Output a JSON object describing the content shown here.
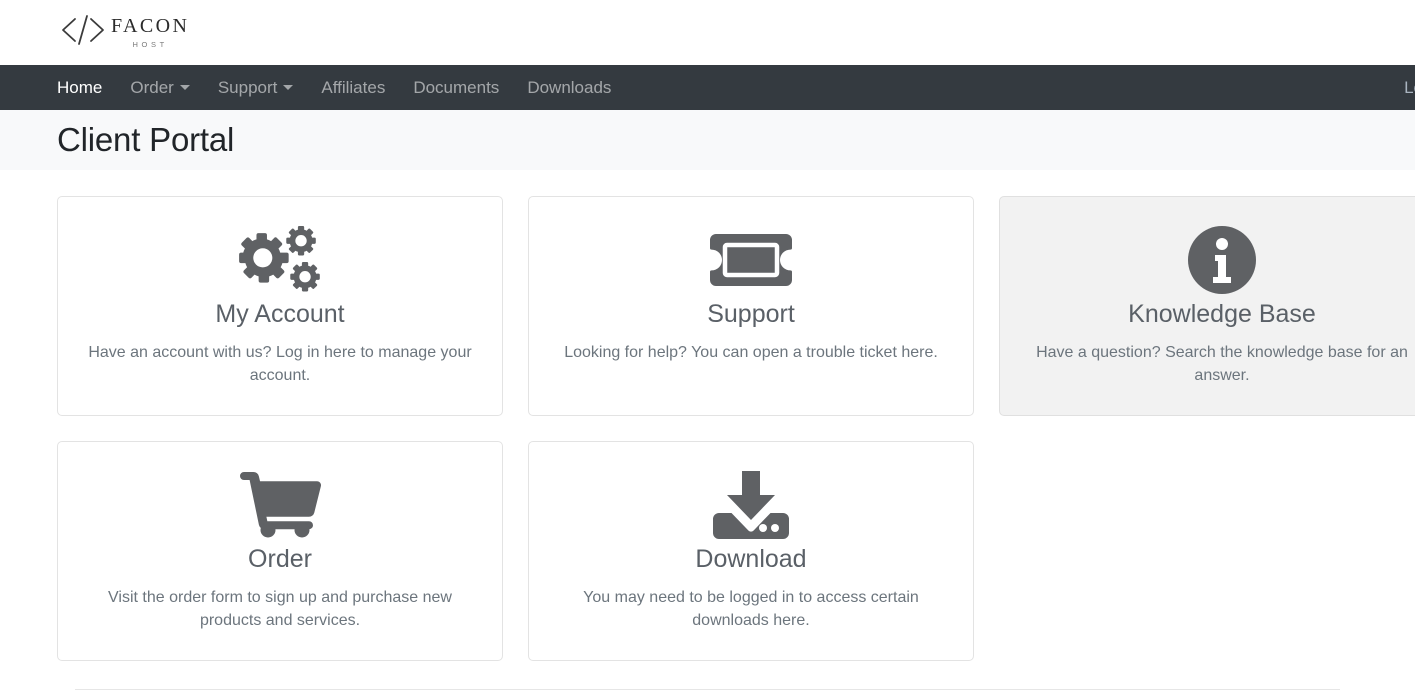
{
  "brand": {
    "name": "FACON",
    "tagline": "HOST",
    "mark_icon": "code-brackets-icon"
  },
  "nav": {
    "items": [
      {
        "label": "Home",
        "active": true,
        "caret": false
      },
      {
        "label": "Order",
        "active": false,
        "caret": true
      },
      {
        "label": "Support",
        "active": false,
        "caret": true
      },
      {
        "label": "Affiliates",
        "active": false,
        "caret": false
      },
      {
        "label": "Documents",
        "active": false,
        "caret": false
      },
      {
        "label": "Downloads",
        "active": false,
        "caret": false
      }
    ],
    "right_label": "Lo",
    "background": "#343a40"
  },
  "header": {
    "title": "Client Portal",
    "band_background": "#f8f9fa"
  },
  "cards": [
    {
      "icon": "gears-icon",
      "title": "My Account",
      "text": "Have an account with us? Log in here to manage your account.",
      "hovered": false
    },
    {
      "icon": "ticket-icon",
      "title": "Support",
      "text": "Looking for help? You can open a trouble ticket here.",
      "hovered": false
    },
    {
      "icon": "info-circle-icon",
      "title": "Knowledge Base",
      "text": "Have a question? Search the knowledge base for an answer.",
      "hovered": true
    },
    {
      "icon": "shopping-cart-icon",
      "title": "Order",
      "text": "Visit the order form to sign up and purchase new products and services.",
      "hovered": false
    },
    {
      "icon": "download-icon",
      "title": "Download",
      "text": "You may need to be logged in to access certain downloads here.",
      "hovered": false
    }
  ],
  "colors": {
    "icon_grey": "#5f6164",
    "title_grey": "#5a6067",
    "text_grey": "#6c757d",
    "card_hover_bg": "#f2f2f2"
  }
}
